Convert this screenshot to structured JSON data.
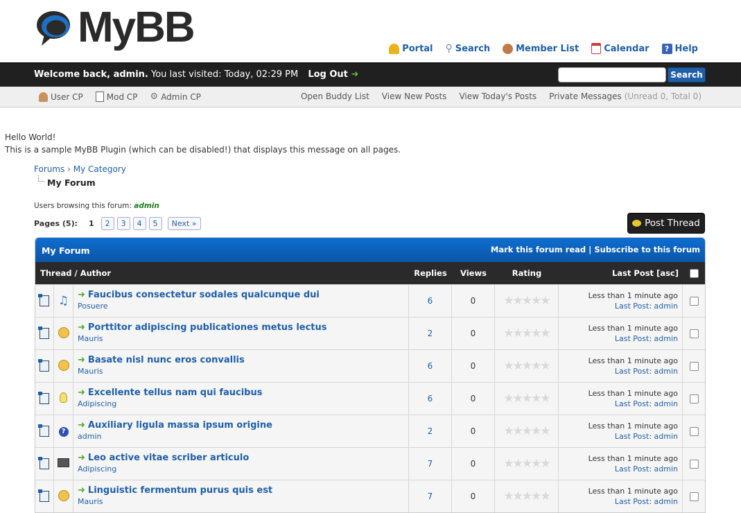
{
  "header": {
    "logo_text": "MyBB",
    "toplinks": [
      {
        "label": "Portal",
        "icon": "bell-icon",
        "color": "#e8b31d"
      },
      {
        "label": "Search",
        "icon": "magnifier-icon",
        "color": "#6f8fb8"
      },
      {
        "label": "Member List",
        "icon": "members-icon",
        "color": "#c07b4a"
      },
      {
        "label": "Calendar",
        "icon": "calendar-icon",
        "color": "#c83c3c"
      },
      {
        "label": "Help",
        "icon": "help-icon",
        "color": "#3a63b8"
      }
    ]
  },
  "panel": {
    "welcome_bold": "Welcome back, admin.",
    "last_visit": "You last visited: Today, 02:29 PM",
    "logout": "Log Out",
    "search_value": "",
    "search_button": "Search"
  },
  "usernav": {
    "left": [
      {
        "label": "User CP",
        "icon": "user-icon"
      },
      {
        "label": "Mod CP",
        "icon": "document-icon"
      },
      {
        "label": "Admin CP",
        "icon": "gear-icon"
      }
    ],
    "right": {
      "buddy": "Open Buddy List",
      "new_posts": "View New Posts",
      "todays_posts": "View Today's Posts",
      "pm": "Private Messages",
      "pm_counts": "(Unread 0, Total 0)"
    }
  },
  "plugin_message": {
    "line1": "Hello World!",
    "line2": "This is a sample MyBB Plugin (which can be disabled!) that displays this message on all pages."
  },
  "breadcrumb": {
    "forums": "Forums",
    "category": "My Category",
    "separator": "›",
    "current": "My Forum"
  },
  "browsing": {
    "label": "Users browsing this forum:",
    "user": "admin"
  },
  "pagination": {
    "label": "Pages (5):",
    "current": "1",
    "pages": [
      "2",
      "3",
      "4",
      "5"
    ],
    "next": "Next »"
  },
  "post_thread_button": "Post Thread",
  "forum_table": {
    "title": "My Forum",
    "mark_read": "Mark this forum read",
    "separator": "|",
    "subscribe": "Subscribe to this forum",
    "columns": {
      "thread": "Thread / Author",
      "replies": "Replies",
      "views": "Views",
      "rating": "Rating",
      "lastpost": "Last Post [asc]"
    },
    "last_post_prefix": "Last Post",
    "rows": [
      {
        "icon": "music-icon",
        "subject": "Faucibus consectetur sodales qualcunque dui",
        "author": "Posuere",
        "replies": "6",
        "views": "0",
        "time": "Less than 1 minute ago",
        "lastposter": "admin"
      },
      {
        "icon": "sad-face-icon",
        "subject": "Porttitor adipiscing publicationes metus lectus",
        "author": "Mauris",
        "replies": "2",
        "views": "0",
        "time": "Less than 1 minute ago",
        "lastposter": "admin"
      },
      {
        "icon": "wink-face-icon",
        "subject": "Basate nisl nunc eros convallis",
        "author": "Mauris",
        "replies": "6",
        "views": "0",
        "time": "Less than 1 minute ago",
        "lastposter": "admin"
      },
      {
        "icon": "lightbulb-icon",
        "subject": "Excellente tellus nam qui faucibus",
        "author": "Adipiscing",
        "replies": "6",
        "views": "0",
        "time": "Less than 1 minute ago",
        "lastposter": "admin"
      },
      {
        "icon": "question-icon",
        "subject": "Auxiliary ligula massa ipsum origine",
        "author": "admin",
        "replies": "2",
        "views": "0",
        "time": "Less than 1 minute ago",
        "lastposter": "admin"
      },
      {
        "icon": "film-icon",
        "subject": "Leo active vitae scriber articulo",
        "author": "Adipiscing",
        "replies": "7",
        "views": "0",
        "time": "Less than 1 minute ago",
        "lastposter": "admin"
      },
      {
        "icon": "smile-face-icon",
        "subject": "Linguistic fermentum purus quis est",
        "author": "Mauris",
        "replies": "7",
        "views": "0",
        "time": "Less than 1 minute ago",
        "lastposter": "admin"
      }
    ]
  }
}
